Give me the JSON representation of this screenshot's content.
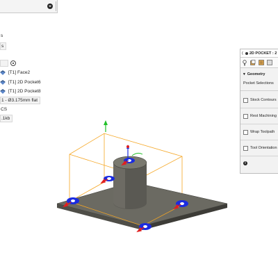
{
  "browser_tree": {
    "items": [
      {
        "label": "s",
        "boxed": false
      },
      {
        "label": "s",
        "boxed": true
      },
      {
        "label": "",
        "boxed": true
      },
      {
        "label": "[T1] Face2",
        "boxed": false,
        "icon": "pocket-operation-icon"
      },
      {
        "label": "[T1] 2D Pocket6",
        "boxed": false,
        "icon": "pocket-operation-icon"
      },
      {
        "label": "[T1] 2D Pocket8",
        "boxed": false,
        "icon": "pocket-operation-icon"
      },
      {
        "label": "1 - Ø3.175mm flat",
        "boxed": true
      },
      {
        "label": "CS",
        "boxed": false
      },
      {
        "label": ".1kb",
        "boxed": true
      }
    ]
  },
  "operation_panel": {
    "title": "2D POCKET : 2",
    "tab_icons": [
      "tool-tab-icon",
      "geometry-tab-icon",
      "heights-tab-icon",
      "passes-tab-icon"
    ],
    "geometry_section": "Geometry",
    "pocket_selections": "Pocket Selections",
    "options": [
      {
        "label": "Stock Contours",
        "checked": false
      },
      {
        "label": "Rest Machining",
        "checked": false
      },
      {
        "label": "Wrap Toolpath",
        "checked": false
      },
      {
        "label": "Tool Orientation",
        "checked": false
      }
    ],
    "footer_icon": "info-icon"
  },
  "colors": {
    "part": "#6b6a62",
    "part_dark": "#4a4a44",
    "bounding_box": "#f5a623",
    "pocket_marker": "#1a2be0",
    "arrow_red": "#e02020",
    "axis_green": "#22c02a"
  }
}
